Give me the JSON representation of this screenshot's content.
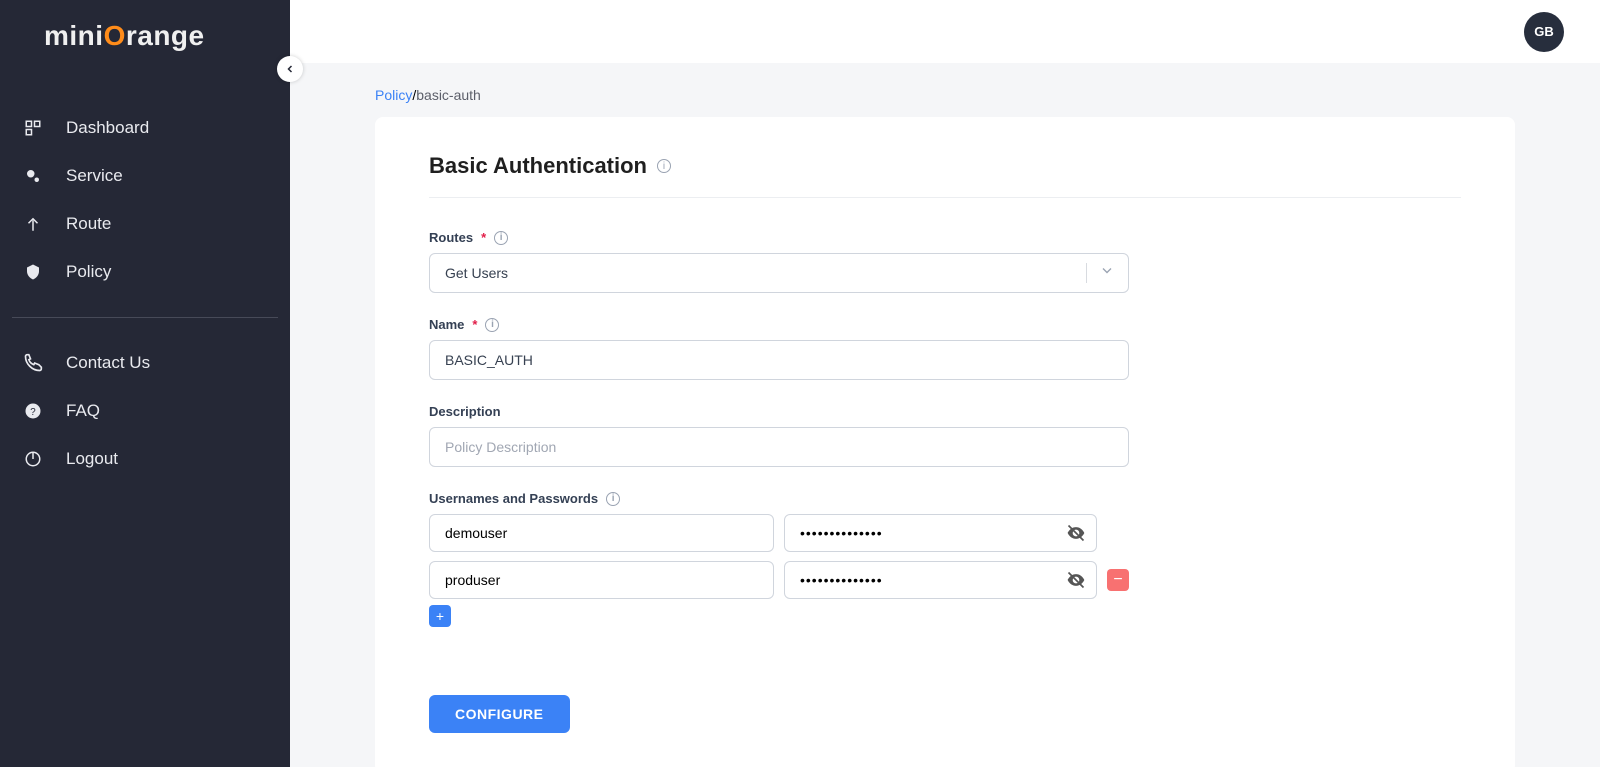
{
  "brand": {
    "text_prefix": "mini",
    "text_suffix": "range"
  },
  "sidebar": {
    "items": [
      {
        "id": "dashboard",
        "label": "Dashboard"
      },
      {
        "id": "service",
        "label": "Service"
      },
      {
        "id": "route",
        "label": "Route"
      },
      {
        "id": "policy",
        "label": "Policy"
      }
    ],
    "bottom_items": [
      {
        "id": "contact",
        "label": "Contact Us"
      },
      {
        "id": "faq",
        "label": "FAQ"
      },
      {
        "id": "logout",
        "label": "Logout"
      }
    ]
  },
  "topbar": {
    "avatar_initials": "GB"
  },
  "breadcrumb": {
    "parent": "Policy",
    "leaf": "basic-auth",
    "separator": "/"
  },
  "page": {
    "title": "Basic Authentication",
    "labels": {
      "routes": "Routes",
      "name": "Name",
      "description": "Description",
      "creds": "Usernames and Passwords"
    },
    "routes_value": "Get Users",
    "name_value": "BASIC_AUTH",
    "description_placeholder": "Policy Description",
    "credentials": [
      {
        "username": "demouser",
        "password": "••••••••••••••"
      },
      {
        "username": "produser",
        "password": "••••••••••••••"
      }
    ],
    "configure_label": "CONFIGURE"
  }
}
